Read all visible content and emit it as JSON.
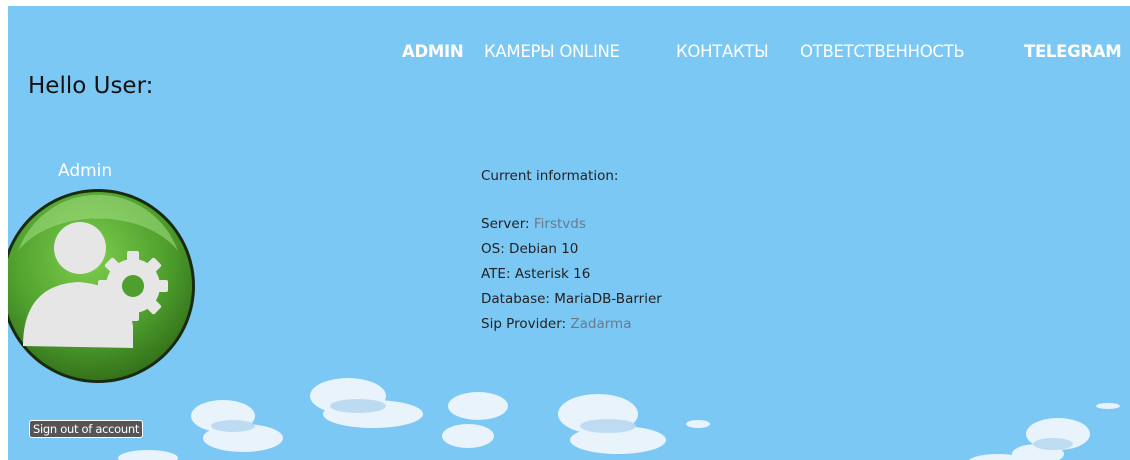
{
  "nav": {
    "items": [
      {
        "label": "ADMIN"
      },
      {
        "label": "КАМЕРЫ ONLINE"
      },
      {
        "label": "КОНТАКТЫ"
      },
      {
        "label": "ОТВЕТСТВЕННОСТЬ"
      },
      {
        "label": "TELEGRAM"
      }
    ]
  },
  "greeting": "Hello User:",
  "profile": {
    "role": "Admin",
    "avatar_icon": "admin-settings-icon",
    "signout_label": "Sign out of account"
  },
  "info": {
    "title": "Current information:",
    "rows": [
      {
        "label": "Server: ",
        "value": "Firstvds"
      },
      {
        "label": "OS: ",
        "value": "Debian 10"
      },
      {
        "label": "ATE: ",
        "value": "Asterisk 16"
      },
      {
        "label": "Database: ",
        "value": "MariaDB-Barrier"
      },
      {
        "label": "Sip Provider: ",
        "value": "Zadarma"
      }
    ]
  },
  "colors": {
    "background": "#7cc8f5",
    "link": "#6a7a8a",
    "avatar_green": "#4a9a2e"
  }
}
